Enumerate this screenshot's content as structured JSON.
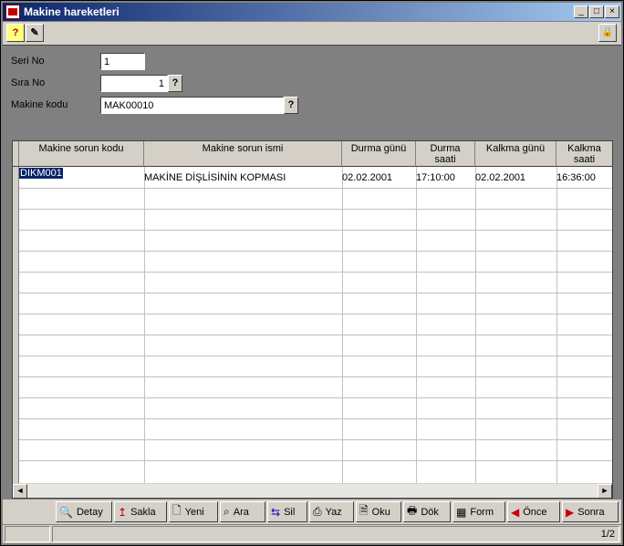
{
  "window": {
    "title": "Makine hareketleri",
    "minimize": "_",
    "maximize": "□",
    "close": "×"
  },
  "toolbar": {
    "help_icon": "?",
    "tools_icon": "✎",
    "lock_icon": "🔒"
  },
  "form": {
    "seri_no_label": "Seri No",
    "seri_no_value": "1",
    "sira_no_label": "Sıra No",
    "sira_no_value": "1",
    "makine_kodu_label": "Makine kodu",
    "makine_kodu_value": "MAK00010",
    "lookup_label": "?"
  },
  "grid": {
    "columns": [
      "Makine sorun kodu",
      "Makine sorun ismi",
      "Durma günü",
      "Durma saati",
      "Kalkma günü",
      "Kalkma saati"
    ],
    "rows": [
      [
        "DIKM001",
        "MAKİNE DİŞLİSİNİN KOPMASI",
        "02.02.2001",
        "17:10:00",
        "02.02.2001",
        "16:36:00"
      ]
    ],
    "scroll_left": "◄",
    "scroll_right": "►"
  },
  "buttons": {
    "detay": "Detay",
    "sakla": "Sakla",
    "yeni": "Yeni",
    "ara": "Ara",
    "sil": "Sil",
    "yaz": "Yaz",
    "oku": "Oku",
    "dok": "Dök",
    "form": "Form",
    "once": "Önce",
    "sonra": "Sonra"
  },
  "status": {
    "page": "1/2"
  }
}
